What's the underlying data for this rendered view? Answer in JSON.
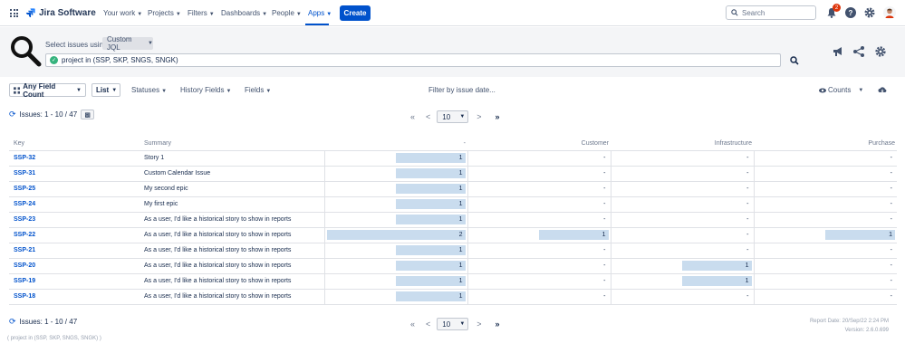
{
  "topnav": {
    "app_name": "Jira Software",
    "items": [
      {
        "label": "Your work"
      },
      {
        "label": "Projects"
      },
      {
        "label": "Filters"
      },
      {
        "label": "Dashboards"
      },
      {
        "label": "People"
      },
      {
        "label": "Apps"
      }
    ],
    "create_label": "Create",
    "search_placeholder": "Search",
    "notification_count": "2",
    "accent": "#0052cc"
  },
  "query": {
    "select_label": "Select issues using",
    "mode": "Custom JQL",
    "jql": "project in (SSP, SKP, SNGS, SNGK)"
  },
  "toolbar": {
    "field_count": "Any Field Count",
    "view": "List",
    "statuses": "Statuses",
    "history_fields": "History Fields",
    "fields": "Fields",
    "filter_by_date": "Filter by issue date...",
    "counts": "Counts"
  },
  "pagination": {
    "issues_text": "Issues: 1 - 10 / 47",
    "page_size": "10",
    "first": "«",
    "prev": "<",
    "next": ">",
    "last": "»"
  },
  "table": {
    "columns": [
      "Key",
      "Summary",
      "-",
      "Customer",
      "Infrastructure",
      "Purchase"
    ],
    "max_value": 2,
    "rows": [
      {
        "key": "SSP-32",
        "summary": "Story 1",
        "v": [
          1,
          null,
          null,
          null
        ]
      },
      {
        "key": "SSP-31",
        "summary": "Custom Calendar Issue",
        "v": [
          1,
          null,
          null,
          null
        ]
      },
      {
        "key": "SSP-25",
        "summary": "My second epic",
        "v": [
          1,
          null,
          null,
          null
        ]
      },
      {
        "key": "SSP-24",
        "summary": "My first epic",
        "v": [
          1,
          null,
          null,
          null
        ]
      },
      {
        "key": "SSP-23",
        "summary": "As a user, I'd like a historical story to show in reports",
        "v": [
          1,
          null,
          null,
          null
        ]
      },
      {
        "key": "SSP-22",
        "summary": "As a user, I'd like a historical story to show in reports",
        "v": [
          2,
          1,
          null,
          1
        ]
      },
      {
        "key": "SSP-21",
        "summary": "As a user, I'd like a historical story to show in reports",
        "v": [
          1,
          null,
          null,
          null
        ]
      },
      {
        "key": "SSP-20",
        "summary": "As a user, I'd like a historical story to show in reports",
        "v": [
          1,
          null,
          1,
          null
        ]
      },
      {
        "key": "SSP-19",
        "summary": "As a user, I'd like a historical story to show in reports",
        "v": [
          1,
          null,
          1,
          null
        ]
      },
      {
        "key": "SSP-18",
        "summary": "As a user, I'd like a historical story to show in reports",
        "v": [
          1,
          null,
          null,
          null
        ]
      }
    ],
    "empty_text": "-",
    "bar_color": "#c9dcee"
  },
  "footer": {
    "report_date": "Report Date: 20/Sep/22 2:24 PM",
    "version": "Version: 2.6.0.699",
    "query_echo": "( project in (SSP, SKP, SNGS, SNGK) )"
  }
}
